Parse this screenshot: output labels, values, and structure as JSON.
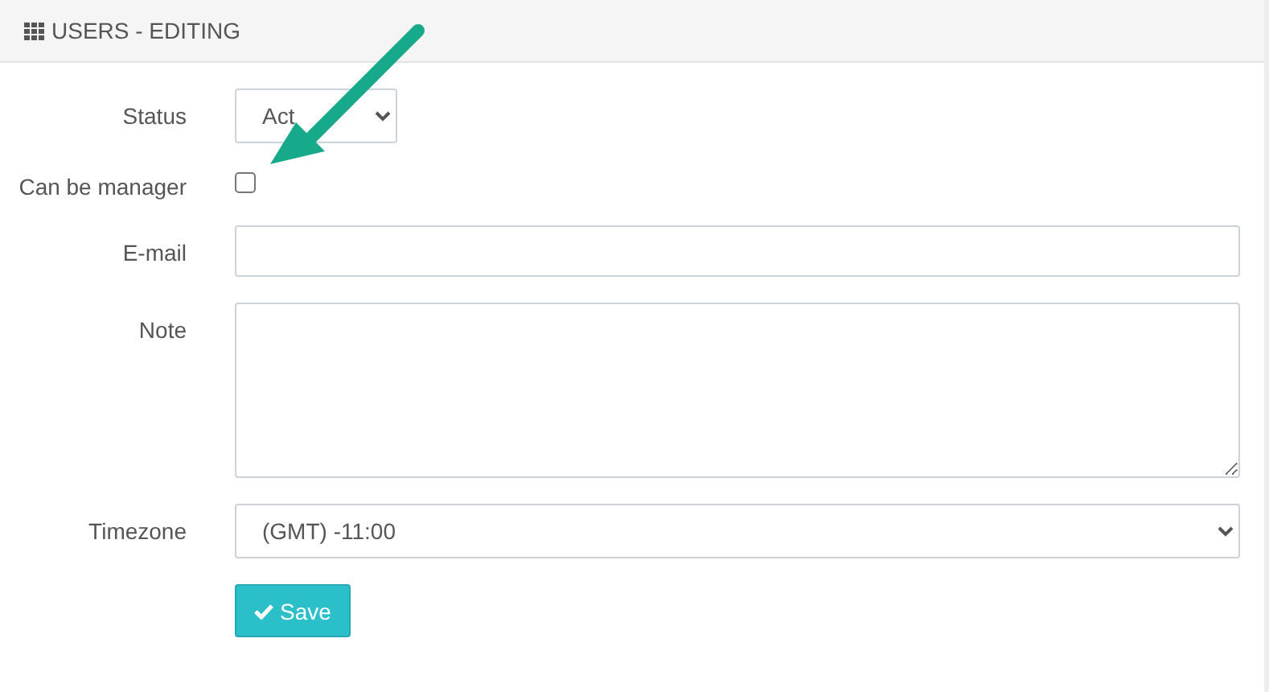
{
  "panel": {
    "title": "USERS - EDITING"
  },
  "fields": [
    {
      "kind": "dropdown",
      "label": "Status",
      "value": "Act"
    },
    {
      "kind": "checkbox",
      "label": "Can be manager",
      "checked": false
    },
    {
      "kind": "text",
      "label": "E-mail"
    },
    {
      "kind": "textarea",
      "label": "Note"
    },
    {
      "kind": "select",
      "label": "Timezone",
      "value": "(GMT) -11:00"
    }
  ],
  "save_button": {
    "label": "Save"
  }
}
